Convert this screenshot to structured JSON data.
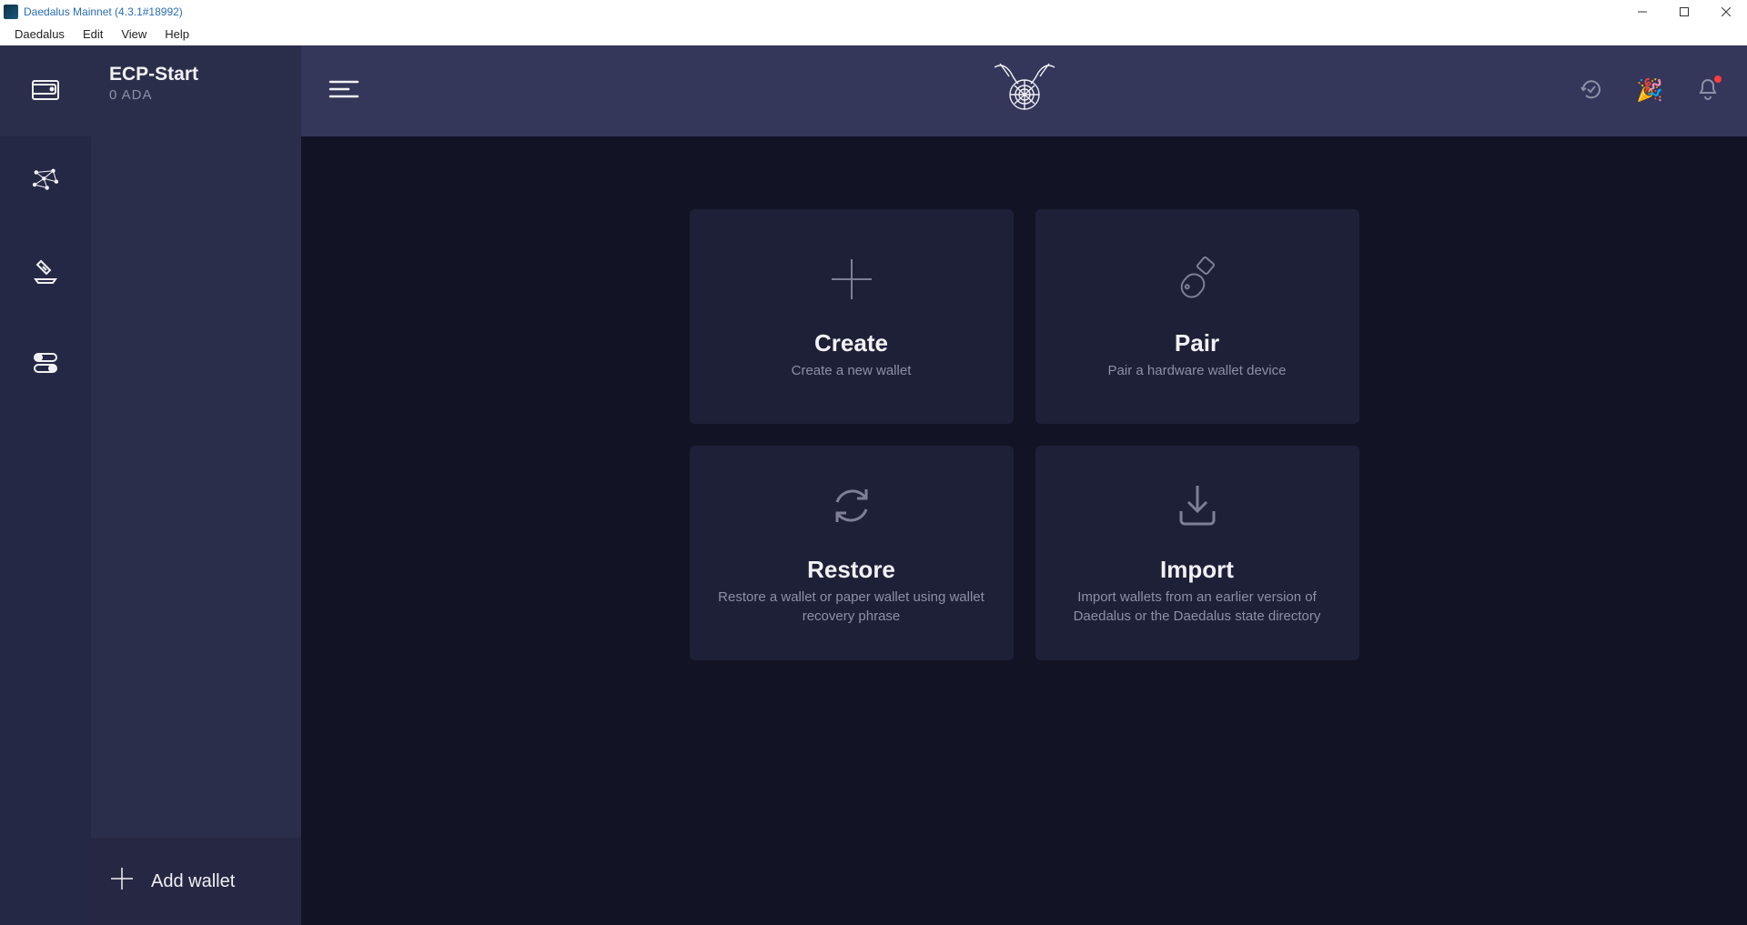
{
  "window": {
    "title": "Daedalus Mainnet (4.3.1#18992)"
  },
  "menubar": {
    "items": [
      "Daedalus",
      "Edit",
      "View",
      "Help"
    ]
  },
  "sidebar": {
    "wallet": {
      "name": "ECP-Start",
      "balance": "0 ADA"
    },
    "add_wallet_label": "Add wallet"
  },
  "cards": {
    "create": {
      "title": "Create",
      "desc": "Create a new wallet"
    },
    "pair": {
      "title": "Pair",
      "desc": "Pair a hardware wallet device"
    },
    "restore": {
      "title": "Restore",
      "desc": "Restore a wallet or paper wallet using wallet recovery phrase"
    },
    "import": {
      "title": "Import",
      "desc": "Import wallets from an earlier version of Daedalus or the Daedalus state directory"
    }
  }
}
